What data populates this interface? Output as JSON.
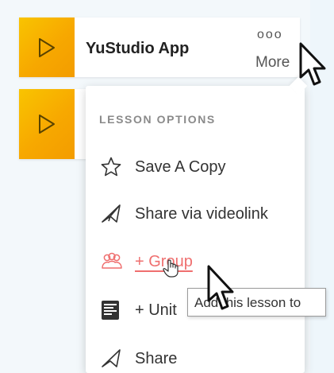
{
  "cards": [
    {
      "title": "YuStudio App",
      "more_label": "More",
      "dots": "ooo"
    },
    {
      "title": ""
    }
  ],
  "menu": {
    "heading": "LESSON OPTIONS",
    "items": [
      {
        "label": "Save A Copy",
        "icon": "star-icon"
      },
      {
        "label": "Share via videolink",
        "icon": "paper-plane-icon"
      },
      {
        "label": "+ Group",
        "icon": "group-icon"
      },
      {
        "label": "+ Unit",
        "icon": "unit-list-icon"
      },
      {
        "label": "Share",
        "icon": "share-icon"
      }
    ]
  },
  "tooltip": {
    "text": "Add this lesson to"
  },
  "colors": {
    "tile_yellow": "#f9c400",
    "tile_orange": "#f39c00",
    "group_accent": "#ef6f6f"
  }
}
